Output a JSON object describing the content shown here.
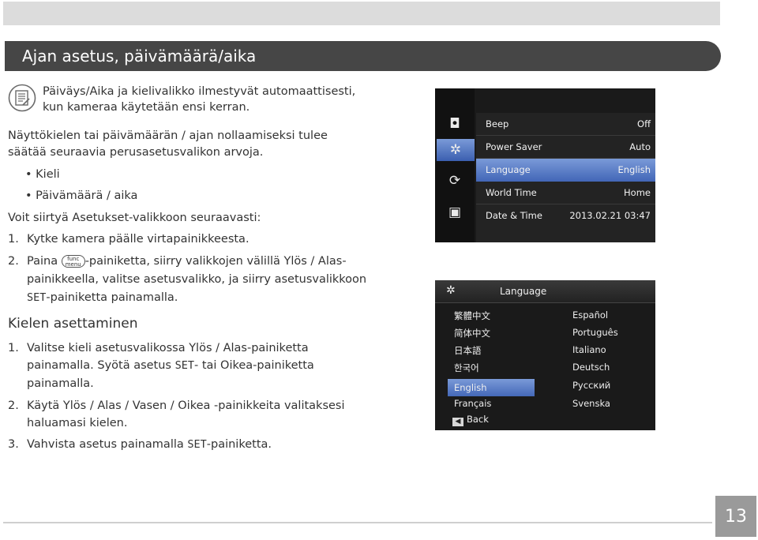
{
  "title": "Ajan asetus, päivämäärä/aika",
  "note": {
    "icon": "note-icon",
    "line1": "Päiväys/Aika ja kielivalikko ilmestyvät automaattisesti,",
    "line2": "kun kameraa käytetään ensi kerran."
  },
  "intro": {
    "line1": "Näyttökielen tai päivämäärän / ajan nollaamiseksi tulee",
    "line2": "säätää seuraavia perusasetusvalikon arvoja."
  },
  "bullets": [
    "• Kieli",
    "• Päivämäärä / aika"
  ],
  "access": "Voit siirtyä Asetukset-valikkoon seuraavasti:",
  "steps1": {
    "s1_num": "1.",
    "s1_text": "Kytke kamera päälle virtapainikkeesta.",
    "s2_num": "2.",
    "s2_pre": "Paina",
    "func_top": "func",
    "func_bottom": "menu",
    "s2_post": "-painiketta, siirry valikkojen välillä Ylös / Alas-",
    "s2_line2": "painikkeella, valitse asetusvalikko, ja siirry asetusvalikkoon",
    "s2_set": "SET",
    "s2_line3": "-painiketta painamalla."
  },
  "section_heading": "Kielen asettaminen",
  "steps2": {
    "s1_num": "1.",
    "s1_line1": "Valitse kieli asetusvalikossa Ylös / Alas-painiketta",
    "s1_line2_pre": "painamalla. Syötä asetus",
    "s1_set": "SET",
    "s1_line2_post": "- tai Oikea-painiketta",
    "s1_line3": "painamalla.",
    "s2_num": "2.",
    "s2_line1": "Käytä Ylös / Alas / Vasen / Oikea -painikkeita valitaksesi",
    "s2_line2": "haluamasi kielen.",
    "s3_num": "3.",
    "s3_pre": "Vahvista asetus painamalla",
    "s3_set": "SET",
    "s3_post": "-painiketta."
  },
  "setup_menu": {
    "tabs": [
      {
        "icon": "camera-icon",
        "glyph": "◘"
      },
      {
        "icon": "setup-tools-icon",
        "glyph": "✲"
      },
      {
        "icon": "refresh-icon",
        "glyph": "⟳"
      },
      {
        "icon": "playback-icon",
        "glyph": "▣"
      }
    ],
    "rows": [
      {
        "label": "Beep",
        "value": "Off"
      },
      {
        "label": "Power Saver",
        "value": "Auto"
      },
      {
        "label": "Language",
        "value": "English"
      },
      {
        "label": "World Time",
        "value": "Home"
      },
      {
        "label": "Date & Time",
        "value": "2013.02.21 03:47"
      }
    ],
    "selected_index": 2
  },
  "language_menu": {
    "header_icon": "setup-tools-icon",
    "title": "Language",
    "left_col": [
      "繁體中文",
      "简体中文",
      "日本語",
      "한국어",
      "English",
      "Français"
    ],
    "right_col": [
      "Español",
      "Português",
      "Italiano",
      "Deutsch",
      "Русский",
      "Svenska"
    ],
    "selected": "English",
    "back_icon": "back-arrow-icon",
    "back_glyph": "◀",
    "back_label": "Back"
  },
  "page_number": "13",
  "colors": {
    "title_bar": "#464646",
    "highlight": "#5b7fcc",
    "page_box": "#9a9a9a"
  }
}
